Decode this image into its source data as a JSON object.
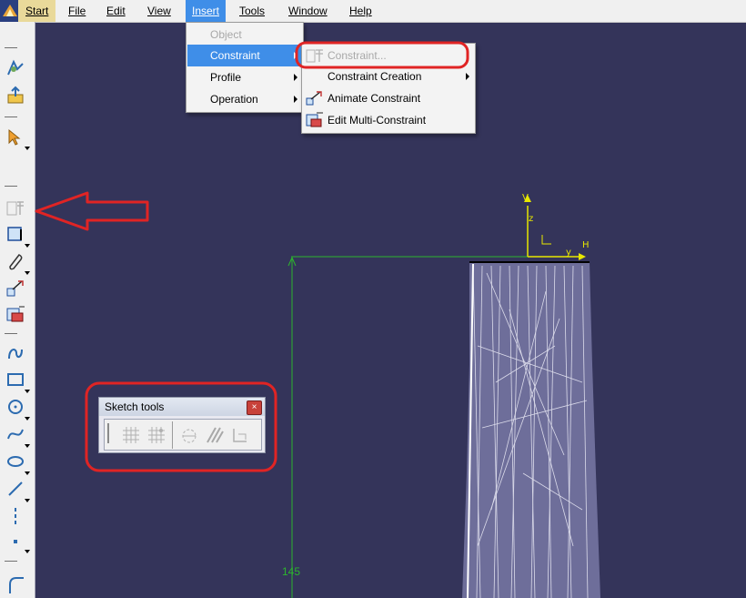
{
  "menubar": {
    "start": "Start",
    "items": [
      "File",
      "Edit",
      "View",
      "Insert",
      "Tools",
      "Window",
      "Help"
    ]
  },
  "insert_menu": {
    "items": [
      {
        "label": "Object",
        "enabled": false,
        "submenu": false
      },
      {
        "label": "Constraint",
        "enabled": true,
        "submenu": true,
        "highlighted": true
      },
      {
        "label": "Profile",
        "enabled": true,
        "submenu": true
      },
      {
        "label": "Operation",
        "enabled": true,
        "submenu": true
      }
    ]
  },
  "constraint_menu": {
    "items": [
      {
        "label": "Constraint...",
        "enabled": false,
        "icon": "constraint-icon"
      },
      {
        "label": "Constraint Creation",
        "enabled": true,
        "submenu": true
      },
      {
        "label": "Animate Constraint",
        "enabled": true,
        "icon": "animate-constraint-icon"
      },
      {
        "label": "Edit Multi-Constraint",
        "enabled": true,
        "icon": "edit-multi-constraint-icon"
      }
    ]
  },
  "sketch_tools": {
    "title": "Sketch tools",
    "close_label": "×",
    "icons": [
      "grid-icon",
      "snap-to-point-icon",
      "construction-element-icon",
      "geometrical-constraints-icon",
      "dimensional-constraints-icon"
    ]
  },
  "viewport": {
    "dimension_value": "145",
    "axis_v": "V",
    "axis_h": "H",
    "axis_z": "z",
    "axis_y": "y"
  },
  "colors": {
    "background": "#34345a",
    "menu_highlight": "#3f8ee8",
    "annotation_red": "#e02424",
    "dimension_green": "#2db52d",
    "axis_yellow": "#e7e700"
  }
}
